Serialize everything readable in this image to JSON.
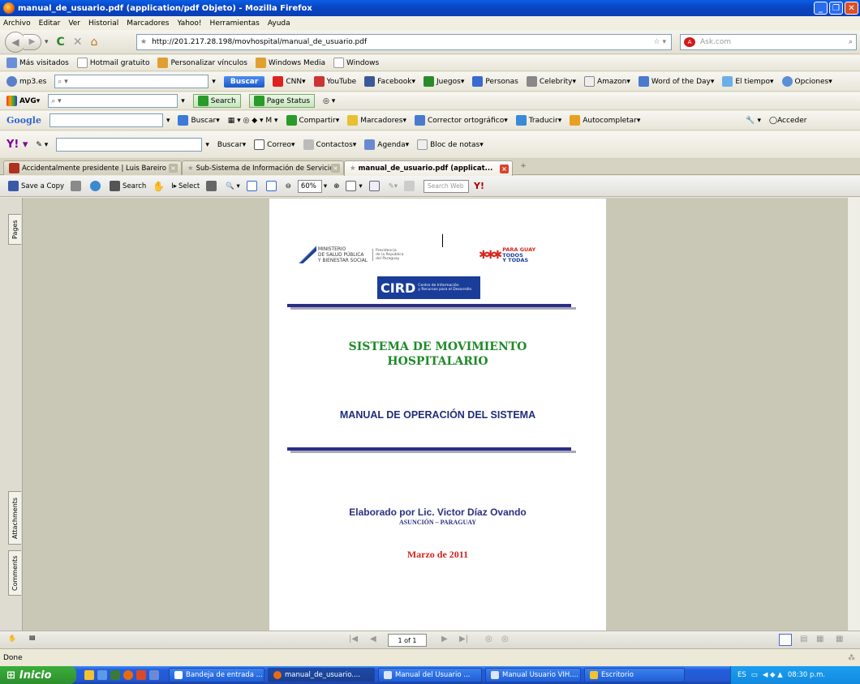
{
  "window": {
    "title": "manual_de_usuario.pdf (application/pdf Objeto) - Mozilla Firefox"
  },
  "menu": [
    "Archivo",
    "Editar",
    "Ver",
    "Historial",
    "Marcadores",
    "Yahoo!",
    "Herramientas",
    "Ayuda"
  ],
  "nav": {
    "url": "http://201.217.28.198/movhospital/manual_de_usuario.pdf",
    "search_placeholder": "Ask.com"
  },
  "bookmarks": [
    "Más visitados",
    "Hotmail gratuito",
    "Personalizar vínculos",
    "Windows Media",
    "Windows"
  ],
  "ask_toolbar": {
    "site": "mp3.es",
    "buscar": "Buscar",
    "items": [
      "CNN",
      "YouTube",
      "Facebook",
      "Juegos",
      "Personas",
      "Celebrity",
      "Amazon",
      "Word of the Day",
      "El tiempo",
      "Opciones"
    ]
  },
  "avg_toolbar": {
    "brand": "AVG",
    "search": "Search",
    "page_status": "Page Status"
  },
  "google_toolbar": {
    "brand": "Google",
    "items": [
      "Buscar",
      "Compartir",
      "Marcadores",
      "Corrector ortográfico",
      "Traducir",
      "Autocompletar"
    ],
    "acceder": "Acceder"
  },
  "yahoo_toolbar": {
    "buscar": "Buscar",
    "items": [
      "Correo",
      "Contactos",
      "Agenda",
      "Bloc de notas"
    ]
  },
  "tabs": [
    {
      "label": "Accidentalmente presidente | Luis Bareiro",
      "active": false
    },
    {
      "label": "Sub-Sistema de Información de Servicio...",
      "active": false
    },
    {
      "label": "manual_de_usuario.pdf (applicat...",
      "active": true
    }
  ],
  "reader_toolbar": {
    "save": "Save a Copy",
    "search": "Search",
    "select": "Select",
    "zoom": "60%",
    "search_web": "Search Web"
  },
  "side_tabs": {
    "pages": "Pages",
    "attachments": "Attachments",
    "comments": "Comments"
  },
  "document": {
    "ministerio": [
      "MINISTERIO",
      "DE SALUD PÚBLICA",
      "Y BIENESTAR SOCIAL"
    ],
    "presidencia": [
      "Presidencia",
      "de la República",
      "del Paraguay"
    ],
    "para_guay": [
      "PARA GUAY",
      "TODOS",
      "Y TODAS"
    ],
    "cird_main": "CIRD",
    "cird_sub": [
      "Centro de Información",
      "y Recursos para el Desarrollo"
    ],
    "title_line1": "SISTEMA DE MOVIMIENTO",
    "title_line2": "HOSPITALARIO",
    "subtitle": "MANUAL DE OPERACIÓN DEL SISTEMA",
    "author": "Elaborado por Lic. Victor Díaz Ovando",
    "place": "ASUNCIÓN – PARAGUAY",
    "date": "Marzo de 2011"
  },
  "pager": {
    "page": "1 of 1"
  },
  "status": "Done",
  "taskbar": {
    "start": "Inicio",
    "tasks": [
      "Bandeja de entrada ...",
      "manual_de_usuario....",
      "Manual del Usuario ...",
      "Manual Usuario VIH....",
      "Escritorio"
    ],
    "lang": "ES",
    "time": "08:30 p.m."
  }
}
